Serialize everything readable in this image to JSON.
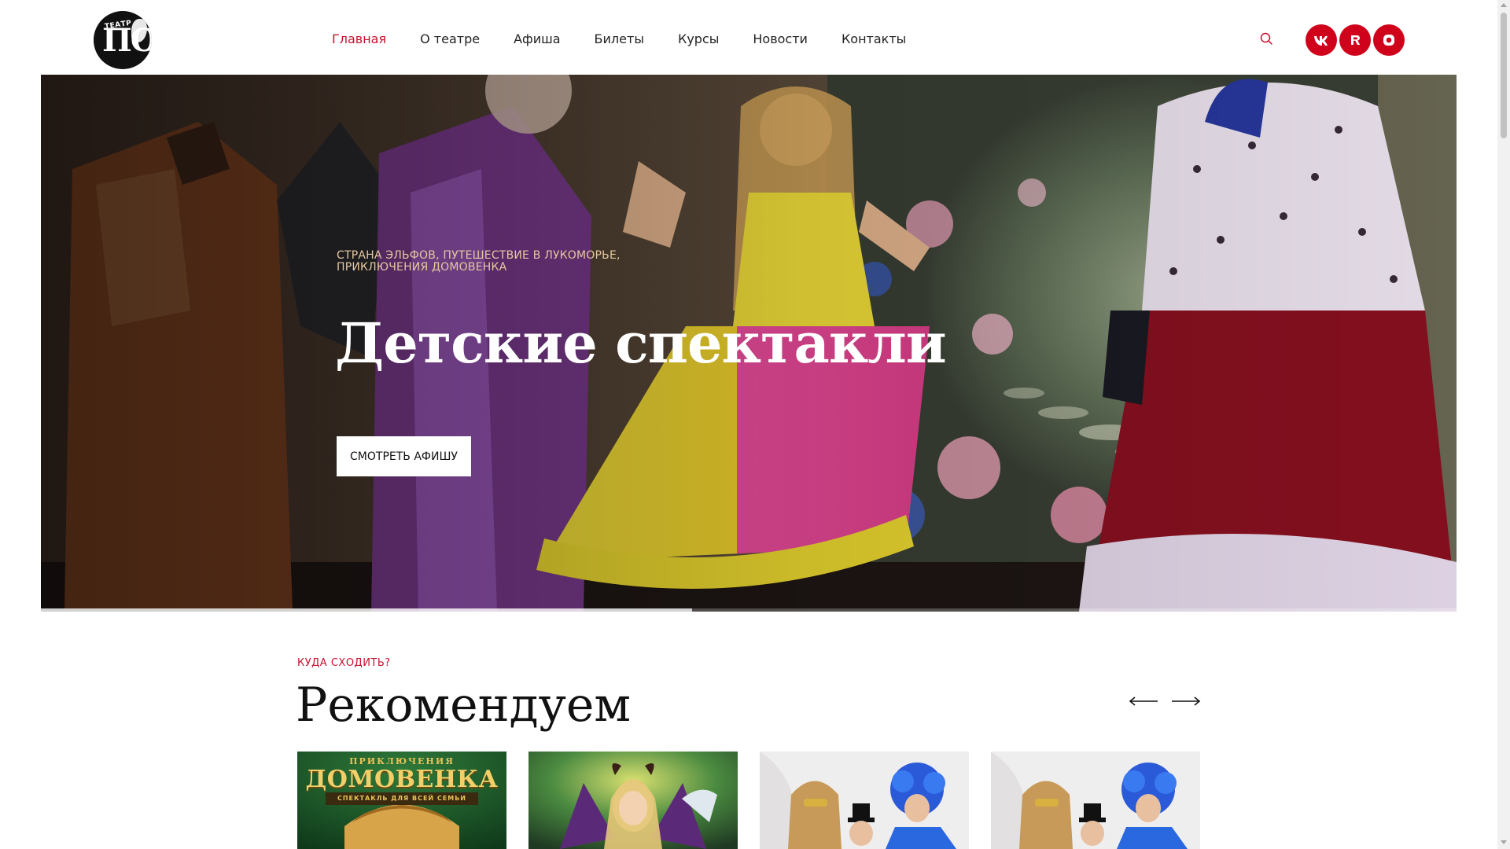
{
  "logo": {
    "small": "ТЕАТР",
    "big": "ПО"
  },
  "nav": [
    {
      "label": "Главная",
      "active": true
    },
    {
      "label": "О театре",
      "active": false
    },
    {
      "label": "Афиша",
      "active": false
    },
    {
      "label": "Билеты",
      "active": false
    },
    {
      "label": "Курсы",
      "active": false
    },
    {
      "label": "Новости",
      "active": false
    },
    {
      "label": "Контакты",
      "active": false
    }
  ],
  "header_icons": {
    "search": "search-icon"
  },
  "social": [
    {
      "name": "vk-icon",
      "glyph": "vk"
    },
    {
      "name": "rutube-icon",
      "glyph": "R"
    },
    {
      "name": "chat-icon",
      "glyph": "◘"
    }
  ],
  "colors": {
    "accent": "#c8102e",
    "social_bg": "#d0021b"
  },
  "hero": {
    "eyebrow": "Страна эльфов, Путешествие в Лукоморье, Приключения Домовенка",
    "title": "Детские спектакли",
    "button": "Смотреть афишу",
    "slide_progress": 0.46
  },
  "recommend": {
    "eyebrow": "КУДА СХОДИТЬ?",
    "title": "Рекомендуем",
    "cards": [
      {
        "title_small": "ПРИКЛЮЧЕНИЯ",
        "title_big": "ДОМОВЕНКА",
        "subtitle": "СПЕКТАКЛЬ ДЛЯ ВСЕЙ СЕМЬИ"
      },
      {
        "title_small": "",
        "title_big": "",
        "subtitle": ""
      },
      {
        "title_small": "",
        "title_big": "",
        "subtitle": ""
      },
      {
        "title_small": "",
        "title_big": "",
        "subtitle": ""
      }
    ]
  }
}
